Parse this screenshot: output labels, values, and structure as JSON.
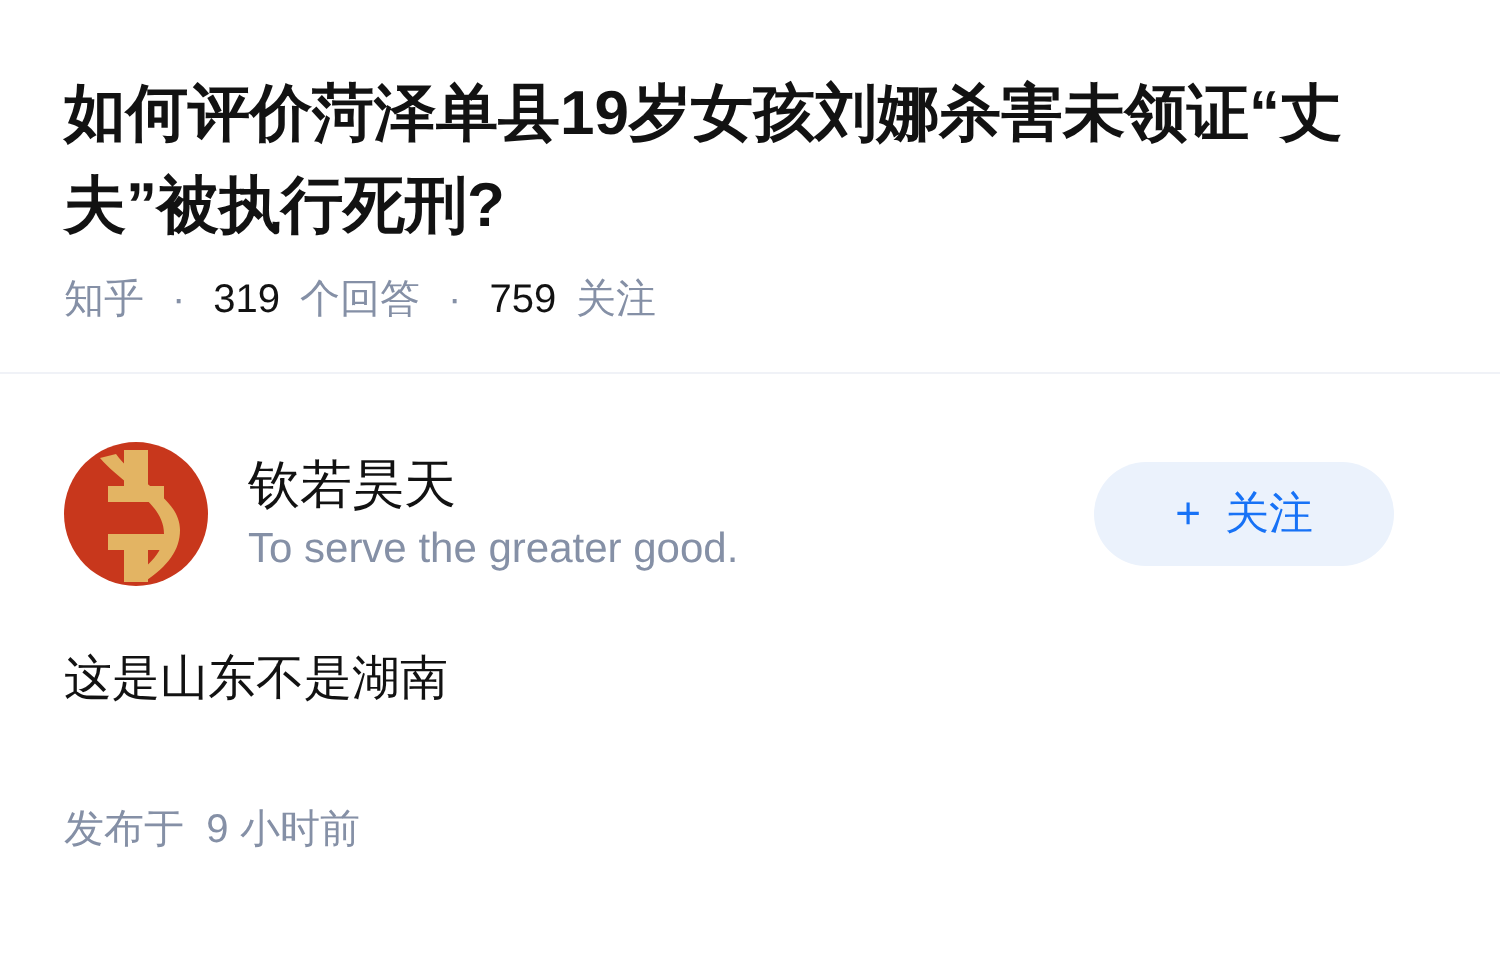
{
  "question": {
    "title": "如何评价菏泽单县19岁女孩刘娜杀害未领证“丈夫”被执行死刑?",
    "source": "知乎",
    "separator_1": "·",
    "answer_count": "319",
    "answer_label": "个回答",
    "separator_2": "·",
    "follower_count": "759",
    "follower_label": "关注"
  },
  "answer": {
    "author": {
      "name": "钦若昊天",
      "bio": "To serve the greater good."
    },
    "follow_button": {
      "icon": "+",
      "label": "关注"
    },
    "content": "这是山东不是湖南",
    "time": "发布于  9 小时前"
  }
}
